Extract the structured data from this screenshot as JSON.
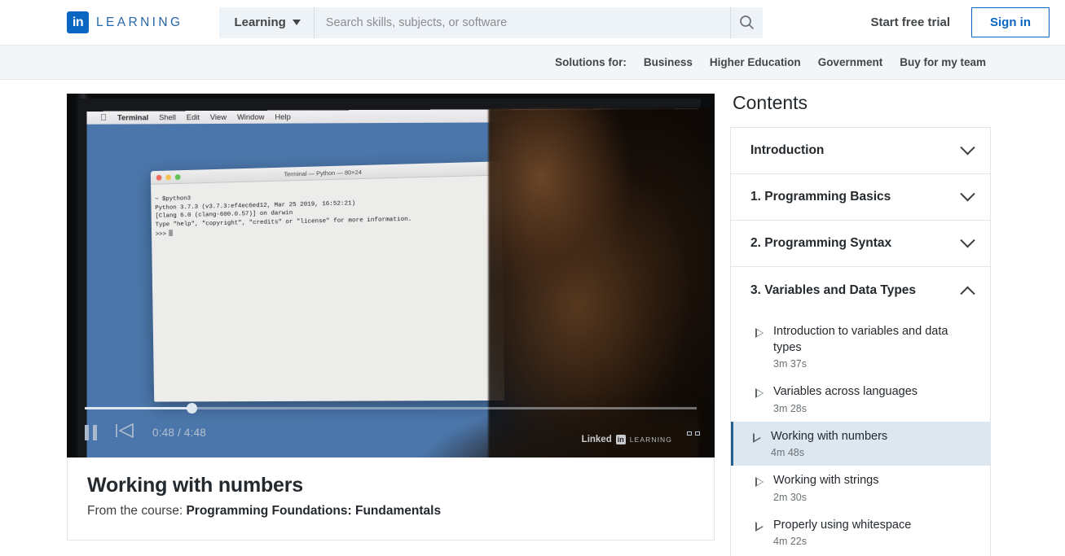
{
  "header": {
    "brand_mark": "in",
    "brand_word": "LEARNING",
    "learning_dropdown": "Learning",
    "search_placeholder": "Search skills, subjects, or software",
    "search_value": "",
    "search_icon": "search-icon",
    "free_trial": "Start free trial",
    "sign_in": "Sign in"
  },
  "subnav": {
    "label": "Solutions for:",
    "links": [
      "Business",
      "Higher Education",
      "Government",
      "Buy for my team"
    ]
  },
  "video": {
    "macbar": {
      "apple": "",
      "items": [
        "Terminal",
        "Shell",
        "Edit",
        "View",
        "Window",
        "Help"
      ]
    },
    "terminal": {
      "title": "Terminal — Python — 80×24",
      "lines": [
        "~ $python3",
        "Python 3.7.3 (v3.7.3:ef4ec6ed12, Mar 25 2019, 16:52:21)",
        "[Clang 6.0 (clang-600.0.57)] on darwin",
        "Type \"help\", \"copyright\", \"credits\" or \"license\" for more information.",
        ">>>"
      ]
    },
    "controls": {
      "pause": "pause-button",
      "previous": "previous-button",
      "time": "0:48 / 4:48",
      "progress_percent": 17.5,
      "fullscreen": "fullscreen-button"
    },
    "watermark": {
      "linked": "Linked",
      "in": "in",
      "learning": "LEARNING"
    }
  },
  "lesson_card": {
    "title": "Working with numbers",
    "from_label": "From the course: ",
    "course_name": "Programming Foundations: Fundamentals"
  },
  "contents": {
    "heading": "Contents",
    "chapters": [
      {
        "title": "Introduction",
        "expanded": false,
        "lessons": []
      },
      {
        "title": "1. Programming Basics",
        "expanded": false,
        "lessons": []
      },
      {
        "title": "2. Programming Syntax",
        "expanded": false,
        "lessons": []
      },
      {
        "title": "3. Variables and Data Types",
        "expanded": true,
        "lessons": [
          {
            "name": "Introduction to variables and data types",
            "duration": "3m 37s",
            "active": false
          },
          {
            "name": "Variables across languages",
            "duration": "3m 28s",
            "active": false
          },
          {
            "name": "Working with numbers",
            "duration": "4m 48s",
            "active": true
          },
          {
            "name": "Working with strings",
            "duration": "2m 30s",
            "active": false
          },
          {
            "name": "Properly using whitespace",
            "duration": "4m 22s",
            "active": false
          }
        ]
      }
    ]
  },
  "colors": {
    "brand_blue": "#0a66c2",
    "link_blue": "#2867a8",
    "active_bg": "#dde7ef",
    "active_border": "#25628f",
    "subnav_bg": "#f3f6f8",
    "search_bg": "#eef3f8"
  }
}
